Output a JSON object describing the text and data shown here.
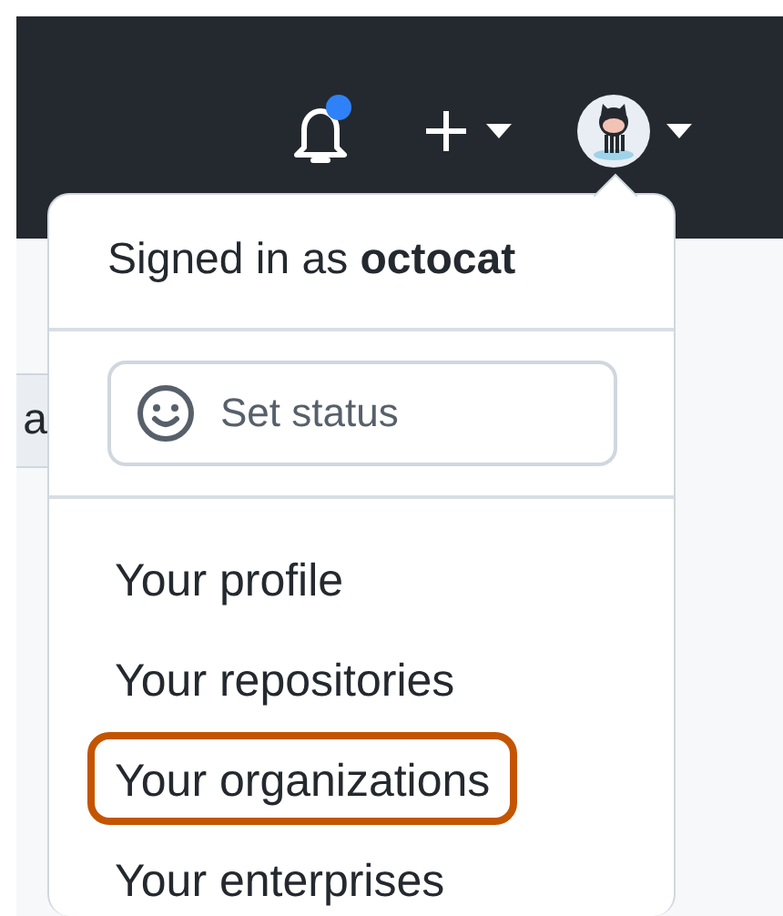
{
  "header": {
    "notifications": {
      "unread": true
    }
  },
  "background_tab": {
    "label": "a"
  },
  "menu": {
    "signed_in_prefix": "Signed in as",
    "username": "octocat",
    "status_button": {
      "label": "Set status"
    },
    "items": [
      {
        "label": "Your profile",
        "highlighted": false
      },
      {
        "label": "Your repositories",
        "highlighted": false
      },
      {
        "label": "Your organizations",
        "highlighted": true
      },
      {
        "label": "Your enterprises",
        "highlighted": false
      }
    ]
  }
}
